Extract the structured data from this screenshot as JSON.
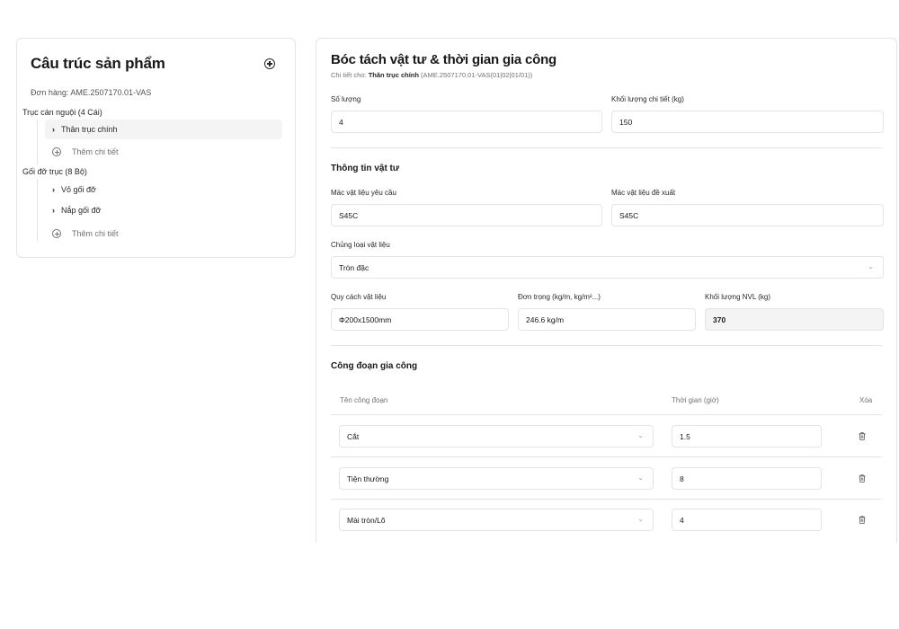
{
  "left": {
    "title": "Câu trúc sản phẩm",
    "order": "Đơn hàng: AME.2507170.01-VAS",
    "groups": [
      {
        "label": "Trục cán nguội (4 Cái)",
        "items": [
          "Thân trục chính"
        ],
        "add_label": "Thêm chi tiết"
      },
      {
        "label": "Gối đỡ trục (8 Bộ)",
        "items": [
          "Vỏ gối đỡ",
          "Nắp gối đỡ"
        ],
        "add_label": "Thêm chi tiết"
      }
    ]
  },
  "right": {
    "title": "Bóc tách vật tư & thời gian gia công",
    "sub_prefix": "Chi tiết cho:",
    "sub_name": "Thân trục chính",
    "sub_code": "(AME.2507170.01-VAS(01|02|01/01))",
    "quantity": {
      "label": "Số lượng",
      "value": "4"
    },
    "weight": {
      "label": "Khối lượng chi tiết (kg)",
      "value": "150"
    },
    "material_section": "Thông tin vật tư",
    "required_grade": {
      "label": "Mác vật liệu yêu cầu",
      "value": "S45C"
    },
    "proposed_grade": {
      "label": "Mác vật liệu đề xuất",
      "value": "S45C"
    },
    "material_type": {
      "label": "Chủng loại vật liệu",
      "value": "Tròn đặc"
    },
    "spec": {
      "label": "Quy cách vật liệu",
      "value": "Φ200x1500mm"
    },
    "unit_weight": {
      "label": "Đơn trọng (kg/m, kg/m²...)",
      "value": "246.6 kg/m"
    },
    "material_weight": {
      "label": "Khối lượng NVL (kg)",
      "value": "370"
    },
    "process_section": "Công đoạn gia công",
    "table_headers": {
      "name": "Tên công đoạn",
      "time": "Thời gian (giờ)",
      "delete": "Xóa"
    },
    "processes": [
      {
        "name": "Cắt",
        "time": "1.5"
      },
      {
        "name": "Tiện thường",
        "time": "8"
      },
      {
        "name": "Mài tròn/Lõ",
        "time": "4"
      }
    ]
  }
}
